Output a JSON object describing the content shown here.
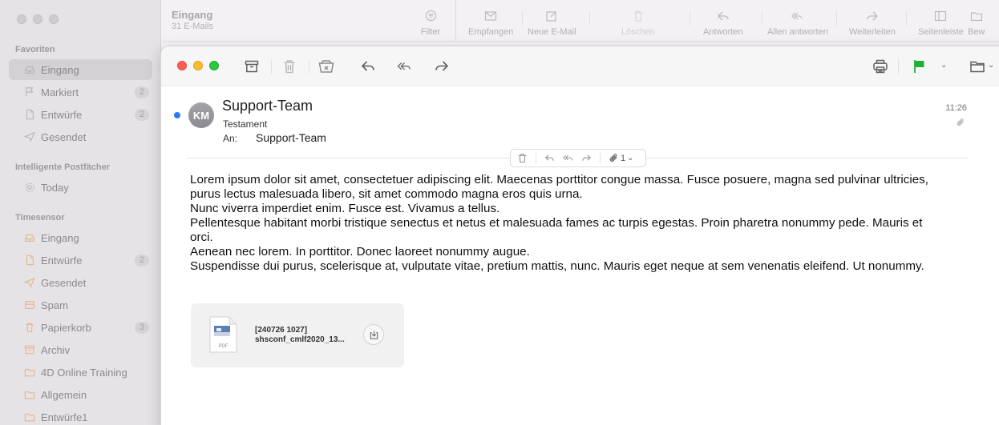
{
  "colors": {
    "accent_blue": "#2a7bf6",
    "flag_green": "#1fb035",
    "close_red": "#ff5f57",
    "min_yellow": "#febc2e",
    "zoom_green": "#28c840"
  },
  "sidebar": {
    "sections": [
      {
        "title": "Favoriten"
      },
      {
        "title": "Intelligente Postfächer"
      },
      {
        "title": "Timesensor"
      }
    ],
    "items": [
      {
        "label": "Eingang",
        "icon": "inbox-icon",
        "count": "",
        "active": true
      },
      {
        "label": "Markiert",
        "icon": "flag-icon",
        "count": "2"
      },
      {
        "label": "Entwürfe",
        "icon": "draft-icon",
        "count": "2"
      },
      {
        "label": "Gesendet",
        "icon": "send-icon",
        "count": ""
      },
      {
        "label": "Today",
        "icon": "gear-icon",
        "count": ""
      },
      {
        "label": "Eingang",
        "icon": "inbox-icon",
        "count": ""
      },
      {
        "label": "Entwürfe",
        "icon": "draft-icon",
        "count": "2"
      },
      {
        "label": "Gesendet",
        "icon": "send-icon",
        "count": ""
      },
      {
        "label": "Spam",
        "icon": "junk-icon",
        "count": ""
      },
      {
        "label": "Papierkorb",
        "icon": "trash-icon",
        "count": "3"
      },
      {
        "label": "Archiv",
        "icon": "archive-icon",
        "count": ""
      },
      {
        "label": "4D Online Training",
        "icon": "folder-icon",
        "count": ""
      },
      {
        "label": "Allgemein",
        "icon": "folder-icon",
        "count": ""
      },
      {
        "label": "Entwürfe1",
        "icon": "folder-icon",
        "count": ""
      }
    ]
  },
  "main_toolbar": {
    "mailbox_title": "Eingang",
    "mailbox_subtitle": "31 E-Mails",
    "filter_label": "Filter",
    "tools": [
      {
        "label": "Empfangen",
        "icon": "envelope-icon"
      },
      {
        "label": "Neue E-Mail",
        "icon": "compose-icon"
      },
      {
        "label": "Löschen",
        "icon": "trash-icon"
      },
      {
        "label": "Antworten",
        "icon": "reply-icon"
      },
      {
        "label": "Allen antworten",
        "icon": "reply-all-icon"
      },
      {
        "label": "Weiterleiten",
        "icon": "forward-icon"
      },
      {
        "label": "Seitenleiste",
        "icon": "sidebar-icon"
      },
      {
        "label": "Bew",
        "icon": "move-icon"
      }
    ]
  },
  "message": {
    "avatar_initials": "KM",
    "sender": "Support-Team",
    "subject": "Testament",
    "to_label": "An:",
    "to_value": "Support-Team",
    "time": "11:26",
    "attachment_count": "1",
    "body_lines": [
      "Lorem ipsum dolor sit amet, consectetuer adipiscing elit. Maecenas porttitor congue massa. Fusce posuere, magna sed pulvinar ultricies,",
      "purus lectus malesuada libero, sit amet commodo magna eros quis urna.",
      "Nunc viverra imperdiet enim. Fusce est. Vivamus a tellus.",
      "Pellentesque habitant morbi tristique senectus et netus et malesuada fames ac turpis egestas. Proin pharetra nonummy pede. Mauris et",
      "orci.",
      "Aenean nec lorem. In porttitor. Donec laoreet nonummy augue.",
      "Suspendisse dui purus, scelerisque at, vulputate vitae, pretium mattis, nunc. Mauris eget neque at sem venenatis eleifend. Ut nonummy."
    ],
    "attachment": {
      "type_label": "PDF",
      "name_line1": "[240726 1027]",
      "name_line2": "shsconf_cmlf2020_13..."
    }
  }
}
